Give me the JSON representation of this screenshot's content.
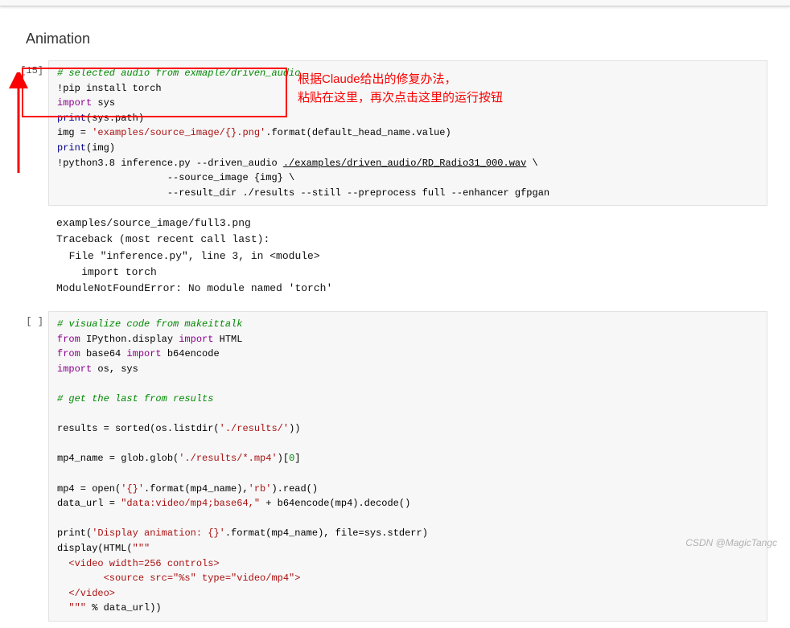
{
  "section": {
    "title": "Animation"
  },
  "cell1": {
    "prompt": "[15]",
    "code": {
      "l1": "# selected audio from exmaple/driven_audio",
      "l2_cmd": "!pip install torch",
      "l3_kw": "import",
      "l3_mod": " sys",
      "l4_print": "print",
      "l4_arg": "sys.path",
      "l5a": "img = ",
      "l5b": "'examples/source_image/{}.png'",
      "l5c": ".format(default_head_name.value)",
      "l6_print": "print",
      "l6_arg": "img",
      "l7_pre": "!python3.8 inference.py --driven_audio ",
      "l7_path": "./examples/driven_audio/RD_Radio31_000.wav",
      "l7_tail": " \\",
      "l8": "                   --source_image {img} \\",
      "l9": "                   --result_dir ./results --still --preprocess full --enhancer gfpgan"
    }
  },
  "output1": {
    "l1": "examples/source_image/full3.png",
    "l2": "Traceback (most recent call last):",
    "l3": "  File \"inference.py\", line 3, in <module>",
    "l4": "    import torch",
    "l5": "ModuleNotFoundError: No module named 'torch'"
  },
  "cell2": {
    "prompt": "[ ]",
    "code": {
      "l1": "# visualize code from makeittalk",
      "l2_from": "from",
      "l2_mod": " IPython.display ",
      "l2_imp": "import",
      "l2_what": " HTML",
      "l3_from": "from",
      "l3_mod": " base64 ",
      "l3_imp": "import",
      "l3_what": " b64encode",
      "l4_imp": "import",
      "l4_what": " os, sys",
      "l5": "# get the last from results",
      "l7a": "results = sorted(os.listdir(",
      "l7s": "'./results/'",
      "l7b": "))",
      "l9a": "mp4_name = glob.glob(",
      "l9s": "'./results/*.mp4'",
      "l9b": ")[",
      "l9i": "0",
      "l9c": "]",
      "l11a": "mp4 = open(",
      "l11s1": "'{}'",
      "l11b": ".format(mp4_name),",
      "l11s2": "'rb'",
      "l11c": ").read()",
      "l12a": "data_url = ",
      "l12s": "\"data:video/mp4;base64,\"",
      "l12b": " + b64encode(mp4).decode()",
      "l14a": "print(",
      "l14s": "'Display animation: {}'",
      "l14b": ".format(mp4_name), file=sys.stderr)",
      "l15a": "display(HTML(",
      "l15s": "\"\"\"",
      "l16": "  <video width=256 controls>",
      "l17": "        <source src=\"%s\" type=\"video/mp4\">",
      "l18": "  </video>",
      "l19a": "  \"\"\"",
      "l19b": " % data_url))"
    }
  },
  "annotation": {
    "line1": "根据Claude给出的修复办法，",
    "line2": "粘贴在这里，再次点击这里的运行按钮"
  },
  "watermark": "CSDN @MagicTangc"
}
